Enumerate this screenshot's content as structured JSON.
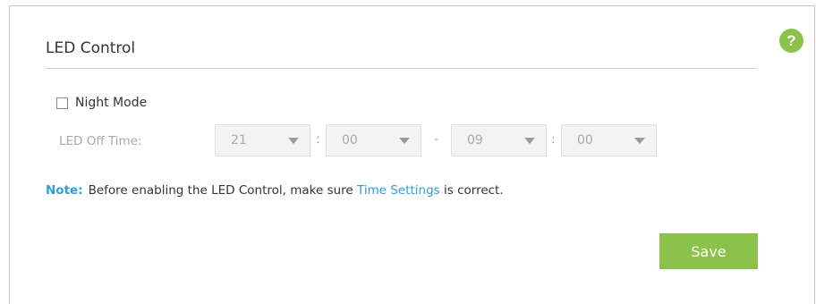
{
  "section": {
    "title": "LED Control"
  },
  "help": {
    "glyph": "?",
    "icon": "help-icon"
  },
  "night_mode": {
    "label": "Night Mode",
    "checked": false
  },
  "led_off_time": {
    "label": "LED Off Time:",
    "start_hour": "21",
    "start_minute": "00",
    "end_hour": "09",
    "end_minute": "00",
    "colon": ":",
    "dash": "-"
  },
  "note": {
    "label": "Note:",
    "text_before": "Before enabling the LED Control, make sure ",
    "link": "Time Settings",
    "text_after": " is correct."
  },
  "actions": {
    "save_label": "Save"
  },
  "colors": {
    "accent_green": "#8bc34a",
    "link_blue": "#2a9fd6"
  }
}
